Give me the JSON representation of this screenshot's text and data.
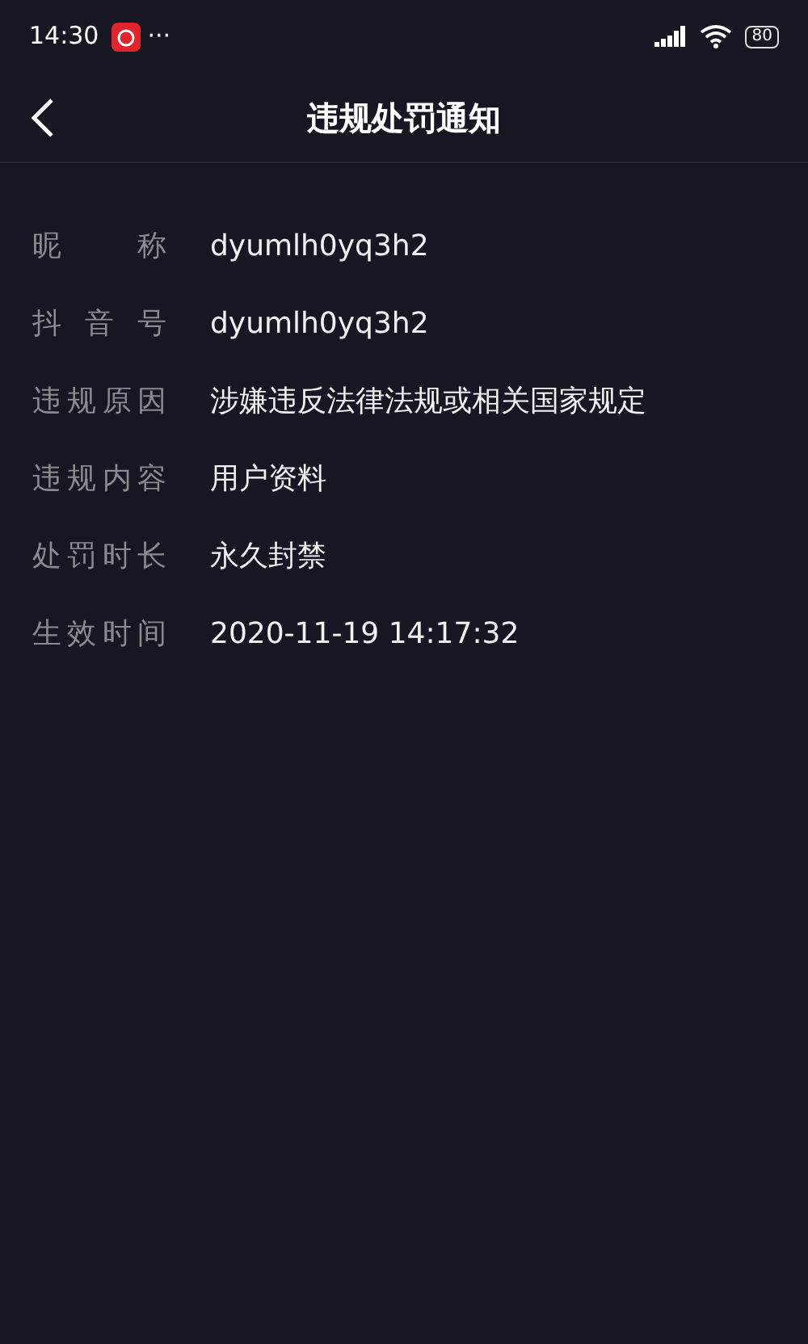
{
  "status_bar": {
    "time": "14:30",
    "more": "···",
    "battery": "80"
  },
  "header": {
    "title": "违规处罚通知"
  },
  "fields": [
    {
      "label": "昵称",
      "value": "dyumlh0yq3h2"
    },
    {
      "label": "抖音号",
      "value": "dyumlh0yq3h2"
    },
    {
      "label": "违规原因",
      "value": "涉嫌违反法律法规或相关国家规定"
    },
    {
      "label": "违规内容",
      "value": "用户资料"
    },
    {
      "label": "处罚时长",
      "value": "永久封禁"
    },
    {
      "label": "生效时间",
      "value": "2020-11-19 14:17:32"
    }
  ]
}
